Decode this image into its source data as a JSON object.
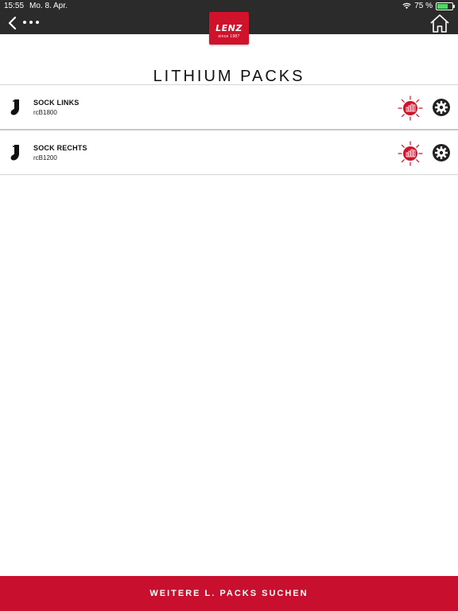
{
  "status_bar": {
    "time": "15:55",
    "date": "Mo. 8. Apr.",
    "battery": "75 %"
  },
  "nav": {
    "back_icon": "chevron-left-icon",
    "more_icon": "more-dots-icon",
    "home_icon": "home-icon",
    "logo": {
      "brand": "LENZ",
      "since": "since 1987"
    }
  },
  "page": {
    "title": "LITHIUM PACKS"
  },
  "devices": [
    {
      "name": "SOCK LINKS",
      "id": "rcB1800",
      "icon": "sock-icon"
    },
    {
      "name": "SOCK RECHTS",
      "id": "rcB1200",
      "icon": "sock-icon"
    }
  ],
  "footer": {
    "search_button": "WEITERE L. PACKS SUCHEN"
  },
  "colors": {
    "accent": "#c8102e",
    "topbar": "#2b2b2b",
    "divider": "#d6d6d6"
  }
}
